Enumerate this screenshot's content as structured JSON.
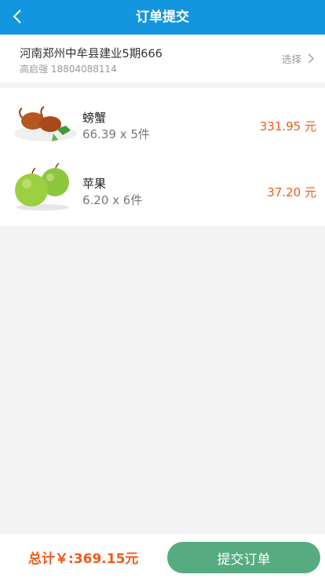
{
  "header": {
    "title": "订单提交",
    "back_icon": "chevron-left-icon"
  },
  "address": {
    "line": "河南郑州中牟县建业5期666",
    "contact": "高启强 18804088114",
    "select_label": "选择",
    "select_icon": "chevron-right-icon"
  },
  "items": [
    {
      "name": "螃蟹",
      "qty": "66.39 x 5件",
      "price": "331.95 元",
      "image": "crab-image"
    },
    {
      "name": "苹果",
      "qty": "6.20 x 6件",
      "price": "37.20 元",
      "image": "apple-image"
    }
  ],
  "footer": {
    "total": "总计￥:369.15元",
    "submit_label": "提交订单"
  },
  "colors": {
    "header": "#1396de",
    "price": "#f05a1a",
    "submit": "#56ab80"
  }
}
